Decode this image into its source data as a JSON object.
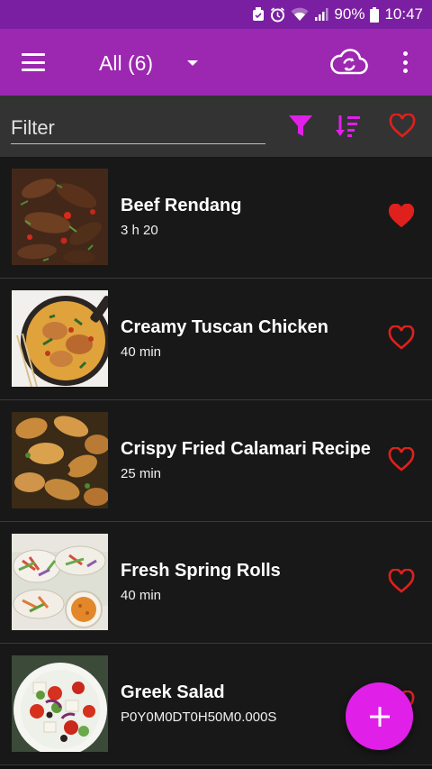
{
  "status_bar": {
    "battery_percent": "90%",
    "time": "10:47",
    "icons": [
      "alarm-icon",
      "clock-icon",
      "wifi-icon",
      "signal-icon",
      "battery-icon"
    ]
  },
  "app_bar": {
    "spinner_label": "All (6)",
    "icons": [
      "menu-icon",
      "dropdown-arrow-icon",
      "cloud-sync-icon",
      "more-vert-icon"
    ]
  },
  "filter_bar": {
    "placeholder": "Filter",
    "icons": [
      "filter-icon",
      "sort-icon",
      "favorite-filter-icon"
    ],
    "accent": "#e020e8",
    "heart_color": "#e0201c"
  },
  "recipes": [
    {
      "title": "Beef Rendang",
      "duration": "3 h 20",
      "favorite": true
    },
    {
      "title": "Creamy Tuscan Chicken",
      "duration": "40 min",
      "favorite": false
    },
    {
      "title": "Crispy Fried Calamari Recipe",
      "duration": "25 min",
      "favorite": false
    },
    {
      "title": "Fresh Spring Rolls",
      "duration": "40 min",
      "favorite": false
    },
    {
      "title": "Greek Salad",
      "duration": "P0Y0M0DT0H50M0.000S",
      "favorite": false
    }
  ],
  "fab": {
    "icon": "add-icon"
  },
  "colors": {
    "status_bar": "#7b1fa2",
    "app_bar": "#9c27b0",
    "filter_bar": "#333333",
    "list_bg": "#181818"
  }
}
